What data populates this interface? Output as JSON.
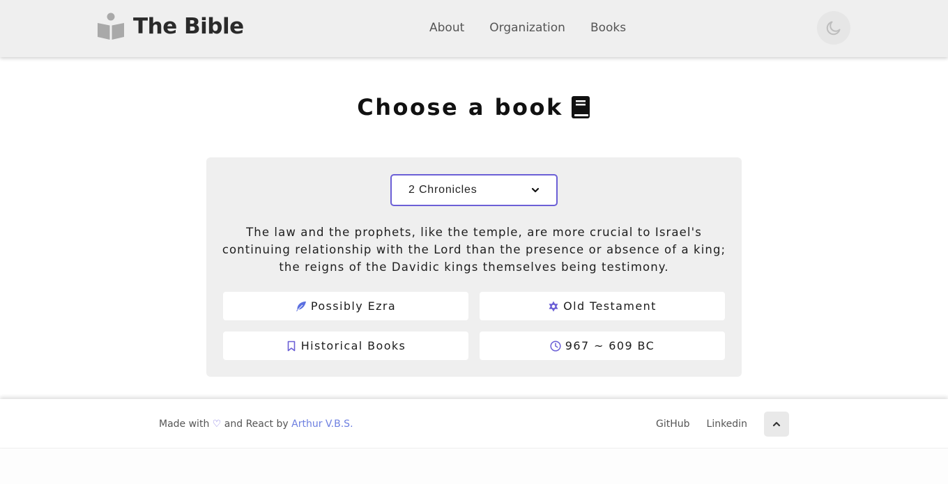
{
  "header": {
    "brand_title": "The Bible",
    "brand_icon": "reader-icon",
    "nav": [
      {
        "label": "About"
      },
      {
        "label": "Organization"
      },
      {
        "label": "Books"
      }
    ],
    "theme_toggle_icon": "moon-icon"
  },
  "main": {
    "title": "Choose a book",
    "title_icon": "book-icon",
    "select": {
      "value": "2 Chronicles",
      "icon": "chevron-down-icon"
    },
    "description": "The law and the prophets, like the temple, are more crucial to Israel's continuing relationship with the Lord than the presence or absence of a king; the reigns of the Davidic kings themselves being testimony.",
    "details": {
      "author": {
        "label": "Possibly Ezra",
        "icon": "feather-icon"
      },
      "testament": {
        "label": "Old Testament",
        "icon": "star-of-david-icon"
      },
      "category": {
        "label": "Historical Books",
        "icon": "bookmark-icon"
      },
      "date": {
        "label": "967 ~ 609 BC",
        "icon": "clock-icon"
      }
    }
  },
  "footer": {
    "made_with": "Made with",
    "heart": "♡",
    "and_react_by": "and React by",
    "author": "Arthur V.B.S.",
    "links": [
      {
        "label": "GitHub"
      },
      {
        "label": "Linkedin"
      }
    ],
    "scroll_top_icon": "chevron-up-icon"
  },
  "colors": {
    "accent": "#6b5fd6",
    "link": "#6d7fe0",
    "header_bg": "#efefef",
    "card_bg": "#efefef"
  }
}
